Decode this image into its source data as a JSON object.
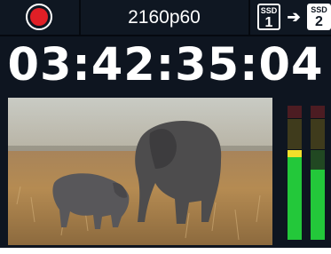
{
  "record_icon": "record-dot-icon",
  "recording_format": "2160p60",
  "timecode": "03:42:35:04",
  "storage": {
    "source": {
      "label": "SSD",
      "number": "1"
    },
    "arrow_icon": "arrow-right-icon",
    "target": {
      "label": "SSD",
      "number": "2"
    }
  },
  "audio_meters": {
    "channel_1": {
      "level": 0.66,
      "peak_marker": "yellow"
    },
    "channel_2": {
      "level": 0.52
    }
  },
  "colors": {
    "record": "#e01f26",
    "meter_green": "#23c83a",
    "meter_yellow": "#f2df2a",
    "background": "#0e1520"
  }
}
